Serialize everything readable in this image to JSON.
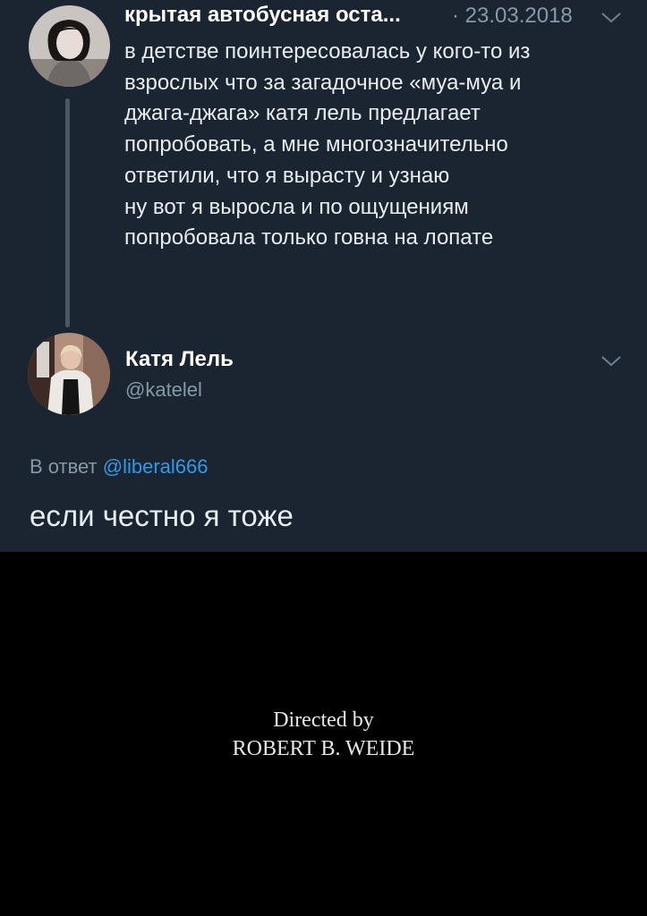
{
  "tweet": {
    "author_name": "крытая автобусная оста...",
    "date": "· 23.03.2018",
    "text": "в детстве поинтересовалась у кого-то из\nвзрослых что за загадочное «муа-муа и\nджага-джага» катя лель предлагает\nпопробовать, а мне многозначительно\nответили, что я вырасту и узнаю\nну вот я выросла и по ощущениям\nпопробовала только говна на лопате",
    "menu_icon": "chevron-down-icon"
  },
  "reply": {
    "author_name": "Катя Лель",
    "handle": "@katelel",
    "reply_to_prefix": "В ответ",
    "reply_to_handle": "@liberal666",
    "text": "если честно я тоже",
    "menu_icon": "chevron-down-icon"
  },
  "credits": {
    "line1": "Directed by",
    "line2": "ROBERT B. WEIDE"
  },
  "colors": {
    "tweet_bg": "#1b2532",
    "link": "#2f9be8",
    "secondary_text": "#8899a6",
    "credits_bg": "#000000"
  }
}
